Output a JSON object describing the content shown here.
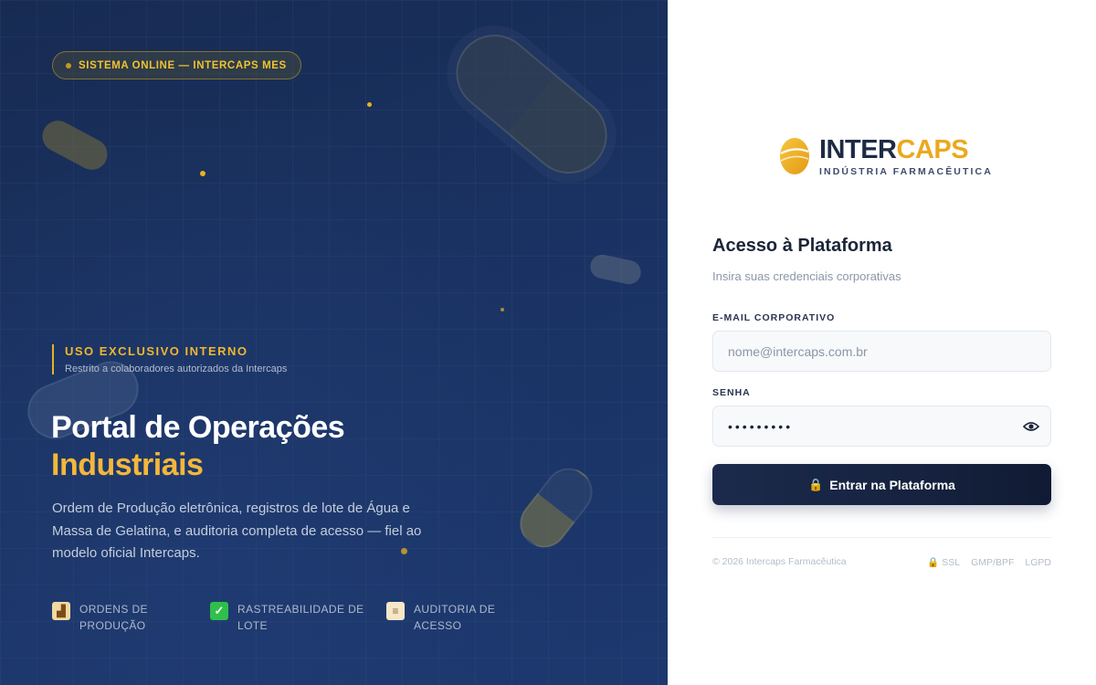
{
  "hero": {
    "status_pill": "SISTEMA ONLINE — INTERCAPS MES",
    "internal_title": "USO EXCLUSIVO INTERNO",
    "internal_subtitle": "Restrito a colaboradores autorizados da Intercaps",
    "title_line1": "Portal de Operações",
    "title_line2": "Industriais",
    "description": "Ordem de Produção eletrônica, registros de lote de Água e Massa de Gelatina, e auditoria completa de acesso — fiel ao modelo oficial Intercaps.",
    "features": [
      {
        "icon": "factory-icon",
        "label": "ORDENS DE PRODUÇÃO"
      },
      {
        "icon": "check-icon",
        "label": "RASTREABILIDADE DE LOTE"
      },
      {
        "icon": "scroll-icon",
        "label": "AUDITORIA DE ACESSO"
      }
    ]
  },
  "login": {
    "brand_part1": "INTER",
    "brand_part2": "CAPS",
    "brand_tagline": "INDÚSTRIA FARMACÊUTICA",
    "title": "Acesso à Plataforma",
    "subtitle": "Insira suas credenciais corporativas",
    "email_label": "E-MAIL CORPORATIVO",
    "email_placeholder": "nome@intercaps.com.br",
    "email_value": "",
    "password_label": "SENHA",
    "password_value": "•••••••••",
    "submit_icon": "🔒",
    "submit_label": "Entrar na Plataforma",
    "footer_copyright": "© 2026 Intercaps Farmacêutica",
    "footer_links": [
      "SSL",
      "GMP/BPF",
      "LGPD"
    ]
  },
  "colors": {
    "hero_bg": "#1a3262",
    "accent": "#e8b21f",
    "brand_dark": "#1e2b45",
    "button_bg": "#16223f"
  }
}
